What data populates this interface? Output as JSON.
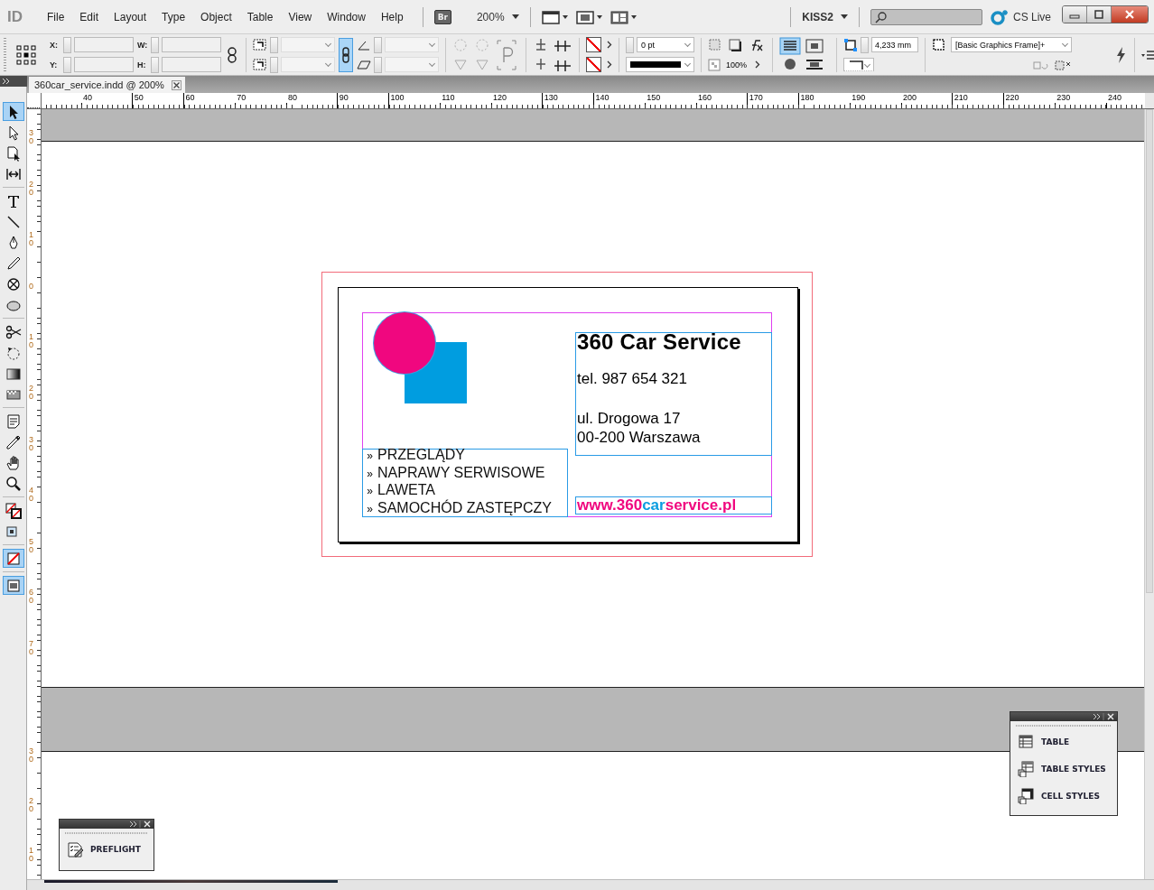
{
  "app_bar": {
    "logo": "ID",
    "menu": [
      "File",
      "Edit",
      "Layout",
      "Type",
      "Object",
      "Table",
      "View",
      "Window",
      "Help"
    ],
    "bridge": "Br",
    "zoom": "200%",
    "workspace": "KISS2",
    "cs_live": "CS Live"
  },
  "control_panel": {
    "x_label": "X:",
    "y_label": "Y:",
    "w_label": "W:",
    "h_label": "H:",
    "constrain_proportions": true,
    "stroke_weight": "0 pt",
    "opacity": "100%",
    "corner_size": "4,233 mm",
    "object_style": "[Basic Graphics Frame]+"
  },
  "document_tab": {
    "title": "360car_service.indd @ 200%"
  },
  "tools": [
    {
      "kind": "selection",
      "selected": true
    },
    {
      "kind": "direct",
      "selected": false
    },
    {
      "kind": "page",
      "selected": false
    },
    {
      "kind": "gap",
      "selected": false
    },
    {
      "kind": "type",
      "selected": false
    },
    {
      "kind": "line",
      "selected": false
    },
    {
      "kind": "pen",
      "selected": false
    },
    {
      "kind": "pencil",
      "selected": false
    },
    {
      "kind": "frame",
      "selected": false
    },
    {
      "kind": "ellipse",
      "selected": false
    },
    {
      "kind": "scissors",
      "selected": false
    },
    {
      "kind": "transform",
      "selected": false
    },
    {
      "kind": "gradient",
      "selected": false
    },
    {
      "kind": "feather",
      "selected": false
    },
    {
      "kind": "note",
      "selected": false
    },
    {
      "kind": "eyedropper",
      "selected": false
    },
    {
      "kind": "hand",
      "selected": false
    },
    {
      "kind": "zoom",
      "selected": false
    },
    {
      "kind": "fillstroke",
      "selected": false
    },
    {
      "kind": "container",
      "selected": false
    },
    {
      "kind": "none",
      "selected": true
    },
    {
      "kind": "screen",
      "selected": true
    }
  ],
  "rulers": {
    "horizontal": [
      "40",
      "50",
      "60",
      "70",
      "80",
      "90",
      "100",
      "110",
      "120",
      "130",
      "140",
      "150",
      "160",
      "170",
      "180",
      "190",
      "200",
      "210",
      "220",
      "230",
      "240"
    ],
    "vertical_page": [
      "30",
      "20",
      "10",
      "0",
      "10",
      "20",
      "30",
      "40",
      "50",
      "60",
      "70"
    ],
    "vertical_next_page": [
      "30",
      "20",
      "10"
    ]
  },
  "card": {
    "title": "360 Car Service",
    "phone": "tel. 987 654 321",
    "address": [
      "ul. Drogowa 17",
      "00-200 Warszawa"
    ],
    "services": [
      {
        "bullet": "»",
        "text": "PRZEGLĄDY"
      },
      {
        "bullet": "»",
        "text": "NAPRAWY SERWISOWE"
      },
      {
        "bullet": "»",
        "text": "LAWETA"
      },
      {
        "bullet": "»",
        "text": "SAMOCHÓD ZASTĘPCZY"
      }
    ],
    "website": [
      {
        "text": "www.360",
        "color": "#f0077f"
      },
      {
        "text": "car",
        "color": "#0a9de0"
      },
      {
        "text": "service.pl",
        "color": "#f0077f"
      }
    ]
  },
  "panels": [
    {
      "items": [
        {
          "kind": "table",
          "label": "TABLE"
        },
        {
          "kind": "table_styles",
          "label": "TABLE STYLES"
        },
        {
          "kind": "cell_styles",
          "label": "CELL STYLES"
        }
      ]
    },
    {
      "items": [
        {
          "kind": "preflight",
          "label": "PREFLIGHT"
        }
      ]
    }
  ]
}
